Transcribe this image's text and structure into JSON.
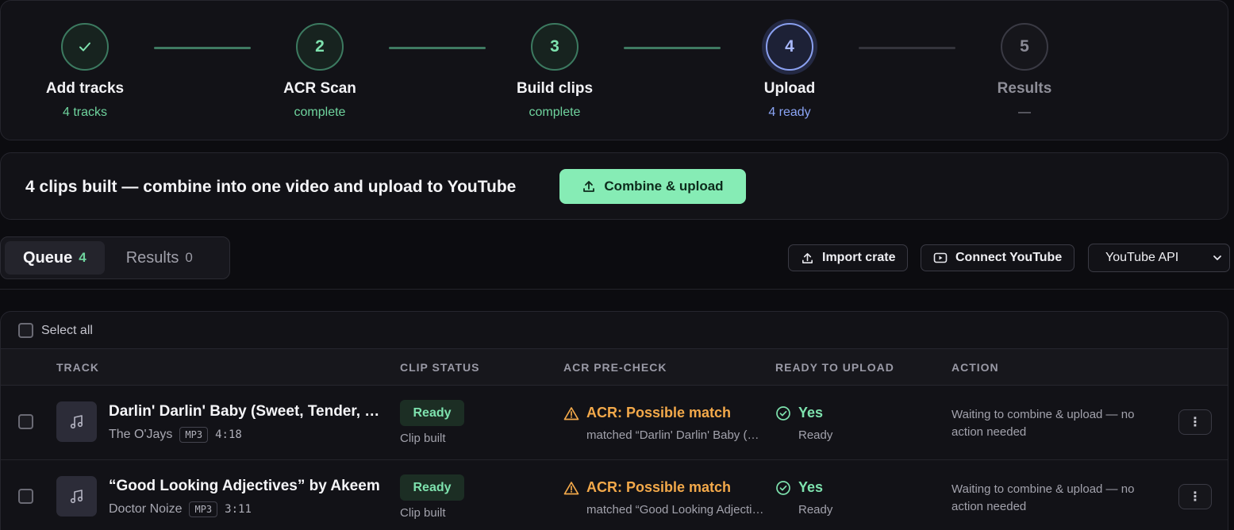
{
  "stepper": {
    "steps": [
      {
        "label": "Add tracks",
        "sub": "4 tracks",
        "num": "✓",
        "state": "done"
      },
      {
        "label": "ACR Scan",
        "sub": "complete",
        "num": "2",
        "state": "done"
      },
      {
        "label": "Build clips",
        "sub": "complete",
        "num": "3",
        "state": "done"
      },
      {
        "label": "Upload",
        "sub": "4 ready",
        "num": "4",
        "state": "current"
      },
      {
        "label": "Results",
        "sub": "—",
        "num": "5",
        "state": "todo"
      }
    ]
  },
  "combine": {
    "message": "4 clips built — combine into one video and upload to YouTube",
    "button_label": "Combine & upload"
  },
  "tabs": [
    {
      "label": "Queue",
      "count": "4",
      "active": true
    },
    {
      "label": "Results",
      "count": "0",
      "active": false
    }
  ],
  "toolbar": {
    "import_label": "Import crate",
    "connect_label": "Connect YouTube",
    "source_select": "YouTube API"
  },
  "table": {
    "select_all_label": "Select all",
    "columns": [
      "TRACK",
      "CLIP STATUS",
      "ACR PRE-CHECK",
      "READY TO UPLOAD",
      "ACTION"
    ],
    "rows": [
      {
        "title": "Darlin' Darlin' Baby (Sweet, Tender, Love)",
        "artist": "The O'Jays",
        "format": "MP3",
        "duration": "4:18",
        "clip_status": "Ready",
        "clip_sub": "Clip built",
        "acr_status": "ACR: Possible match",
        "acr_sub": "matched “Darlin' Darlin' Baby (Sweet, Tender, Love)”",
        "ready": "Yes",
        "ready_sub": "Ready",
        "action": "Waiting to combine & upload — no action needed",
        "menu": "⋮"
      },
      {
        "title": "“Good Looking Adjectives” by Akeem",
        "artist": "Doctor Noize",
        "format": "MP3",
        "duration": "3:11",
        "clip_status": "Ready",
        "clip_sub": "Clip built",
        "acr_status": "ACR: Possible match",
        "acr_sub": "matched “Good Looking Adjectives”",
        "ready": "Yes",
        "ready_sub": "Ready",
        "action": "Waiting to combine & upload — no action needed",
        "menu": "⋮"
      }
    ]
  },
  "colors": {
    "accent_green": "#86ecb5",
    "current_blue": "#8aa0f0",
    "warning_orange": "#f3a94a"
  }
}
